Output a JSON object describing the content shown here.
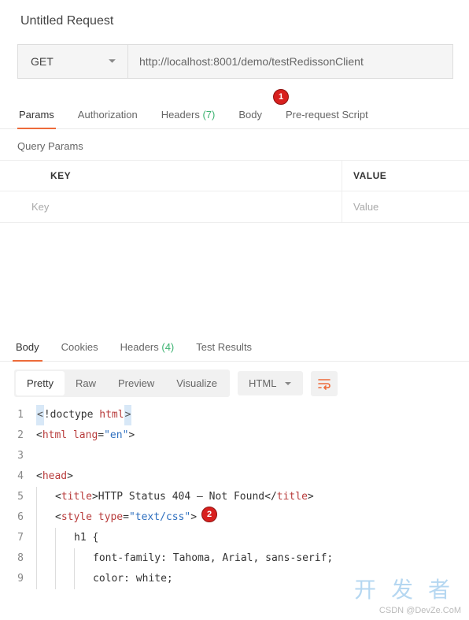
{
  "title": "Untitled Request",
  "request": {
    "method": "GET",
    "url": "http://localhost:8001/demo/testRedissonClient"
  },
  "reqTabs": {
    "items": [
      {
        "label": "Params",
        "count": null,
        "active": true
      },
      {
        "label": "Authorization",
        "count": null,
        "active": false
      },
      {
        "label": "Headers",
        "count": "(7)",
        "active": false
      },
      {
        "label": "Body",
        "count": null,
        "active": false
      },
      {
        "label": "Pre-request Script",
        "count": null,
        "active": false
      }
    ]
  },
  "queryParams": {
    "header": "Query Params",
    "keyLabel": "KEY",
    "valLabel": "VALUE",
    "keyPlaceholder": "Key",
    "valPlaceholder": "Value"
  },
  "respTabs": {
    "items": [
      {
        "label": "Body",
        "count": null,
        "active": true
      },
      {
        "label": "Cookies",
        "count": null,
        "active": false
      },
      {
        "label": "Headers",
        "count": "(4)",
        "active": false
      },
      {
        "label": "Test Results",
        "count": null,
        "active": false
      }
    ]
  },
  "viewModes": {
    "items": [
      {
        "label": "Pretty",
        "active": true
      },
      {
        "label": "Raw",
        "active": false
      },
      {
        "label": "Preview",
        "active": false
      },
      {
        "label": "Visualize",
        "active": false
      }
    ],
    "format": "HTML"
  },
  "code": {
    "lines": [
      {
        "n": "1",
        "indent": 0,
        "parts": [
          {
            "t": "sel",
            "v": "<"
          },
          {
            "t": "text",
            "v": "!doctype "
          },
          {
            "t": "tag",
            "v": "html"
          },
          {
            "t": "sel",
            "v": ">"
          }
        ]
      },
      {
        "n": "2",
        "indent": 0,
        "parts": [
          {
            "t": "text",
            "v": "<"
          },
          {
            "t": "tag",
            "v": "html "
          },
          {
            "t": "attr",
            "v": "lang"
          },
          {
            "t": "text",
            "v": "="
          },
          {
            "t": "str",
            "v": "\"en\""
          },
          {
            "t": "text",
            "v": ">"
          }
        ]
      },
      {
        "n": "3",
        "indent": 0,
        "parts": []
      },
      {
        "n": "4",
        "indent": 0,
        "parts": [
          {
            "t": "text",
            "v": "<"
          },
          {
            "t": "tag",
            "v": "head"
          },
          {
            "t": "text",
            "v": ">"
          }
        ]
      },
      {
        "n": "5",
        "indent": 1,
        "parts": [
          {
            "t": "text",
            "v": "<"
          },
          {
            "t": "tag",
            "v": "title"
          },
          {
            "t": "text",
            "v": ">HTTP Status 404 – Not Found</"
          },
          {
            "t": "tag",
            "v": "title"
          },
          {
            "t": "text",
            "v": ">"
          }
        ]
      },
      {
        "n": "6",
        "indent": 1,
        "parts": [
          {
            "t": "text",
            "v": "<"
          },
          {
            "t": "tag",
            "v": "style "
          },
          {
            "t": "attr",
            "v": "type"
          },
          {
            "t": "text",
            "v": "="
          },
          {
            "t": "str",
            "v": "\"text/css\""
          },
          {
            "t": "text",
            "v": ">"
          }
        ]
      },
      {
        "n": "7",
        "indent": 2,
        "parts": [
          {
            "t": "text",
            "v": "h1 {"
          }
        ]
      },
      {
        "n": "8",
        "indent": 3,
        "parts": [
          {
            "t": "text",
            "v": "font-family: Tahoma, Arial, sans-serif;"
          }
        ]
      },
      {
        "n": "9",
        "indent": 3,
        "parts": [
          {
            "t": "text",
            "v": "color: white;"
          }
        ]
      }
    ]
  },
  "badges": {
    "b1": "1",
    "b2": "2"
  },
  "watermark": {
    "main": "开 发 者",
    "sub": "CSDN @DevZe.CoM"
  }
}
